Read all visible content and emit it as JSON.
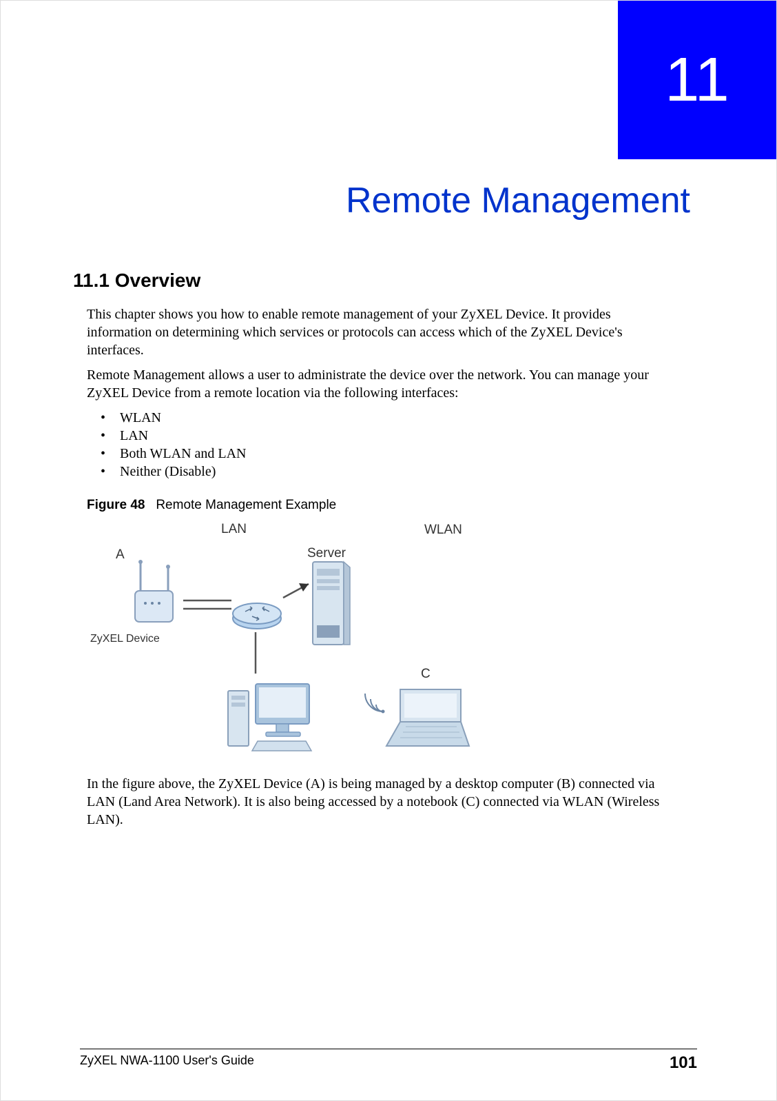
{
  "chapter": {
    "number": "11",
    "title": "Remote Management"
  },
  "section": {
    "heading": "11.1  Overview",
    "para1": "This chapter shows you how to enable remote management of your ZyXEL Device. It provides information on determining which services or protocols can access which of the ZyXEL Device's interfaces.",
    "para2": "Remote Management allows a user to administrate the device over the network. You can manage your ZyXEL Device from a remote location via the following interfaces:",
    "bullets": [
      "WLAN",
      "LAN",
      "Both WLAN and LAN",
      "Neither (Disable)"
    ],
    "para3": "In the figure above, the ZyXEL Device (A) is being managed by a desktop computer (B) connected via LAN (Land Area Network). It is also being accessed by a notebook (C) connected via WLAN (Wireless LAN)."
  },
  "figure": {
    "number": "Figure 48",
    "caption": "Remote Management Example",
    "labels": {
      "lan": "LAN",
      "wlan": "WLAN",
      "a": "A",
      "server": "Server",
      "device": "ZyXEL Device",
      "c": "C"
    }
  },
  "footer": {
    "guide": "ZyXEL NWA-1100 User's Guide",
    "page": "101"
  }
}
